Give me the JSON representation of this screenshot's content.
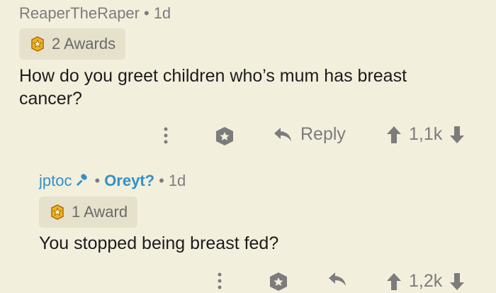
{
  "comments": [
    {
      "username": "ReaperTheRaper",
      "separator": "•",
      "age": "1d",
      "awards_label": "2 Awards",
      "text": "How do you greet children who’s mum has breast cancer?",
      "actions": {
        "reply_label": "Reply",
        "score": "1,1k"
      }
    },
    {
      "username": "jptoc",
      "flair": "Oreyt?",
      "separator": "•",
      "age": "1d",
      "awards_label": "1 Award",
      "text": "You stopped being breast fed?",
      "actions": {
        "reply_label": "",
        "score": "1,2k"
      }
    }
  ],
  "colors": {
    "background": "#f3efdd",
    "award_chip": "#e6e1cb",
    "link_blue": "#3490c8",
    "muted_text": "#7c7c7c",
    "medal_gold": "#f2b21c"
  },
  "icons": {
    "award": "gold-medal-icon",
    "mic": "microphone-icon",
    "more": "kebab-icon",
    "give_award": "award-badge-icon",
    "reply": "reply-arrow-icon",
    "upvote": "up-arrow-icon",
    "downvote": "down-arrow-icon"
  }
}
